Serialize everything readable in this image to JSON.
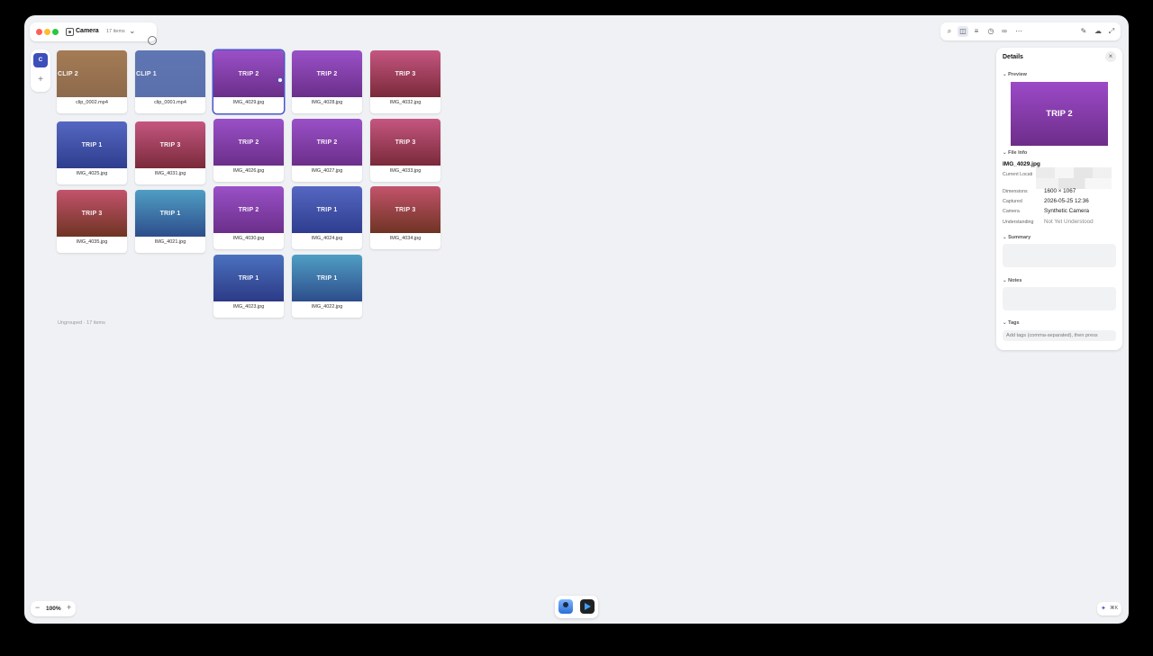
{
  "header": {
    "app_name": "Camera",
    "item_count": "17 items"
  },
  "rail": {
    "collection_initial": "C",
    "add_label": "+"
  },
  "grid": {
    "items": [
      {
        "label": "CLIP 2",
        "name": "clip_0002.mp4"
      },
      {
        "label": "CLIP 1",
        "name": "clip_0001.mp4"
      },
      {
        "label": "TRIP 2",
        "name": "IMG_4029.jpg"
      },
      {
        "label": "TRIP 2",
        "name": "IMG_4028.jpg"
      },
      {
        "label": "TRIP 3",
        "name": "IMG_4032.jpg"
      },
      {
        "label": "TRIP 1",
        "name": "IMG_4025.jpg"
      },
      {
        "label": "TRIP 3",
        "name": "IMG_4031.jpg"
      },
      {
        "label": "TRIP 2",
        "name": "IMG_4026.jpg"
      },
      {
        "label": "TRIP 2",
        "name": "IMG_4027.jpg"
      },
      {
        "label": "TRIP 3",
        "name": "IMG_4033.jpg"
      },
      {
        "label": "TRIP 3",
        "name": "IMG_4035.jpg"
      },
      {
        "label": "TRIP 1",
        "name": "IMG_4021.jpg"
      },
      {
        "label": "TRIP 2",
        "name": "IMG_4030.jpg"
      },
      {
        "label": "TRIP 1",
        "name": "IMG_4024.jpg"
      },
      {
        "label": "TRIP 3",
        "name": "IMG_4034.jpg"
      },
      {
        "label": "TRIP 1",
        "name": "IMG_4023.jpg"
      },
      {
        "label": "TRIP 1",
        "name": "IMG_4022.jpg"
      }
    ],
    "group_label": "Ungrouped · 17 items"
  },
  "details": {
    "title": "Details",
    "close": "×",
    "preview_section": "Preview",
    "preview_label": "TRIP 2",
    "file_info_section": "File Info",
    "file_name": "IMG_4029.jpg",
    "current_location_label": "Current Locati",
    "dimensions_label": "Dimensions",
    "dimensions_value": "1600 × 1067",
    "captured_label": "Captured",
    "captured_value": "2026-05-25 12:36",
    "camera_label": "Camera",
    "camera_value": "Synthetic Camera",
    "understanding_label": "Understanding",
    "understanding_value": "Not Yet Understood",
    "summary_section": "Summary",
    "notes_section": "Notes",
    "tags_section": "Tags",
    "tags_placeholder": "Add tags (comma-separated), then press"
  },
  "zoom": {
    "value": "100%",
    "minus": "−",
    "plus": "+"
  },
  "shortcut": {
    "key": "⌘K"
  }
}
